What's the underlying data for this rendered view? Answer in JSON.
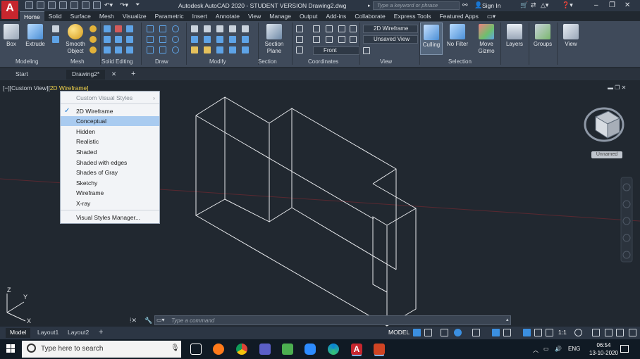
{
  "app": {
    "title": "Autodesk AutoCAD 2020 - STUDENT VERSION   Drawing2.dwg",
    "search_placeholder": "Type a keyword or phrase",
    "sign_in": "Sign In"
  },
  "ribbon_tabs": [
    "Home",
    "Solid",
    "Surface",
    "Mesh",
    "Visualize",
    "Parametric",
    "Insert",
    "Annotate",
    "View",
    "Manage",
    "Output",
    "Add-ins",
    "Collaborate",
    "Express Tools",
    "Featured Apps"
  ],
  "ribbon": {
    "box": "Box",
    "extrude": "Extrude",
    "smooth_object": "Smooth Object",
    "section_plane": "Section Plane",
    "culling": "Culling",
    "no_filter": "No Filter",
    "move_gizmo": "Move Gizmo",
    "layers": "Layers",
    "groups": "Groups",
    "view": "View",
    "visual_style_select": "2D Wireframe",
    "view_select": "Unsaved View",
    "ucs_select": "Front",
    "panels": {
      "modeling": "Modeling",
      "mesh": "Mesh",
      "solid_editing": "Solid Editing",
      "draw": "Draw",
      "modify": "Modify",
      "section": "Section",
      "coordinates": "Coordinates",
      "view": "View",
      "selection": "Selection"
    }
  },
  "file_tabs": {
    "start": "Start",
    "drawing": "Drawing2*"
  },
  "viewport": {
    "controls_prefix": "[−][Custom View][",
    "visual_style": "2D Wireframe",
    "controls_suffix": "]",
    "viewcube_label": "Unnamed"
  },
  "visual_styles_menu": {
    "header": "Custom Visual Styles",
    "items": [
      "2D Wireframe",
      "Conceptual",
      "Hidden",
      "Realistic",
      "Shaded",
      "Shaded with edges",
      "Shades of Gray",
      "Sketchy",
      "Wireframe",
      "X-ray"
    ],
    "manager": "Visual Styles Manager...",
    "checked": "2D Wireframe",
    "highlighted": "Conceptual"
  },
  "command_line": {
    "placeholder": "Type  a  command"
  },
  "layout_tabs": [
    "Model",
    "Layout1",
    "Layout2"
  ],
  "status": {
    "model": "MODEL",
    "scale": "1:1"
  },
  "taskbar": {
    "search": "Type here to search",
    "lang": "ENG",
    "time": "06:54",
    "date": "13-10-2020"
  },
  "colors": {
    "accent": "#1976d2",
    "autocad_red": "#c6262e",
    "highlight": "#a9cbf0"
  }
}
